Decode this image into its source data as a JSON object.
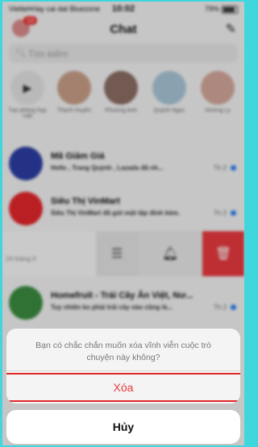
{
  "status": {
    "carrier": "Viettel•Hay cai dat Bluezone",
    "time": "10:02",
    "battery": "79%"
  },
  "header": {
    "title": "Chat",
    "badge": "13"
  },
  "search": {
    "placeholder": "Tìm kiếm"
  },
  "stories": [
    {
      "name": "Tạo phòng họp mặt",
      "kind": "camera"
    },
    {
      "name": "Thanh Huyền"
    },
    {
      "name": "Phương Anh"
    },
    {
      "name": "Quỳnh Ngọc"
    },
    {
      "name": "Hương Ly"
    }
  ],
  "chats": [
    {
      "name": "Mã Giảm Giá",
      "preview": "Hello , Trang Quỳnh , Lazada đã nh...",
      "date": "Th 2",
      "color": "#2c3ea3"
    },
    {
      "name": "Siêu Thị VinMart",
      "preview": "Siêu Thị VinMart đã gửi một tệp đính kèm.",
      "date": "Th 2",
      "color": "#e3262b"
    },
    {
      "name": "Homefruit - Trái Cây Ăn Việt, Nư...",
      "preview": "Tuy nhiên ko phải trái cây nào cũng là...",
      "date": "Th 2",
      "color": "#3a8c3f"
    }
  ],
  "swipe": {
    "ghost_date": "24 tháng 6"
  },
  "sheet": {
    "message": "Bạn có chắc chắn muốn xóa vĩnh viễn cuộc trò chuyện này không?",
    "delete_label": "Xóa",
    "cancel_label": "Hủy"
  }
}
